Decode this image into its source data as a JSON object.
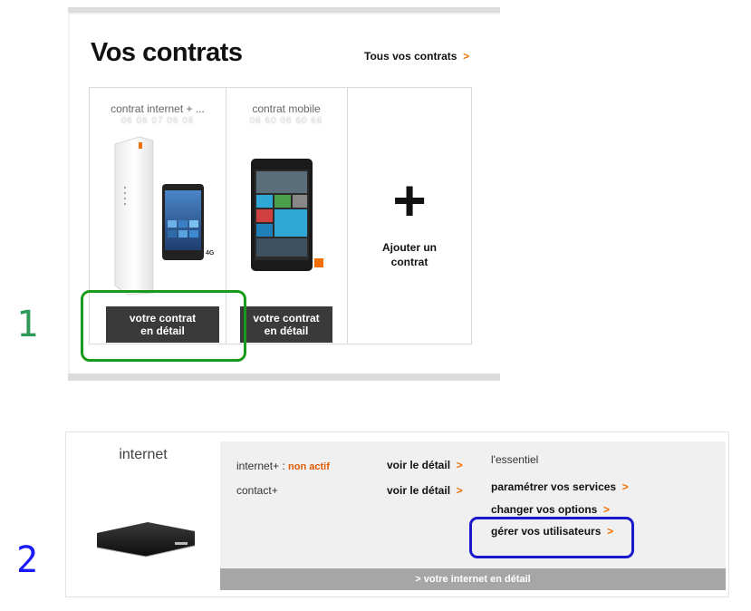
{
  "steps": {
    "step1": "1",
    "step2": "2"
  },
  "contracts": {
    "title": "Vos contrats",
    "all_link": "Tous vos contrats",
    "chevron": ">",
    "cards": [
      {
        "title": "contrat internet + ...",
        "number": "06 06 07 06 06",
        "button_line1": "votre contrat",
        "button_line2": "en détail",
        "badge": "4G"
      },
      {
        "title": "contrat mobile",
        "number": "06 60 06 60 66",
        "button_line1": "votre contrat",
        "button_line2": "en détail"
      }
    ],
    "add": {
      "icon": "+",
      "line1": "Ajouter un",
      "line2": "contrat"
    }
  },
  "internet": {
    "title": "internet",
    "services": [
      {
        "label": "internet+ : ",
        "status": "non actif",
        "link": "voir le détail"
      },
      {
        "label": "contact+",
        "link": "voir le détail"
      }
    ],
    "options_header": "l'essentiel",
    "options": [
      "paramétrer vos services",
      "changer vos options",
      "gérer vos utilisateurs"
    ],
    "footer": "> votre internet en détail"
  },
  "colors": {
    "accent": "#f16e00",
    "green_highlight": "#1a9a1a",
    "blue_highlight": "#1a1acc"
  }
}
